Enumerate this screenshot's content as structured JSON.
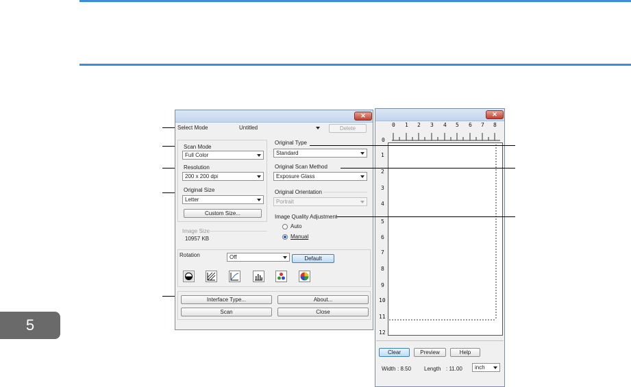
{
  "chapter": "5",
  "scanner_dialog": {
    "select_mode_label": "Select Mode",
    "select_mode_value": "Untitled",
    "delete_label": "Delete",
    "scan_mode_label": "Scan Mode",
    "scan_mode_value": "Full Color",
    "resolution_label": "Resolution",
    "resolution_value": "200 x 200 dpi",
    "original_size_label": "Original Size",
    "original_size_value": "Letter",
    "custom_size_label": "Custom Size...",
    "image_size_label": "Image Size",
    "image_size_value": "10957 KB",
    "original_type_label": "Original Type",
    "original_type_value": "Standard",
    "scan_method_label": "Original Scan Method",
    "scan_method_value": "Exposure Glass",
    "orientation_label": "Original Orientation",
    "orientation_value": "Portrait",
    "quality_label": "Image Quality Adjustment",
    "auto_label": "Auto",
    "manual_label": "Manual",
    "rotation_label": "Rotation",
    "rotation_value": "Off",
    "default_label": "Default",
    "interface_type_label": "Interface Type...",
    "about_label": "About...",
    "scan_label": "Scan",
    "close_label": "Close"
  },
  "preview_window": {
    "ruler_top": [
      "0",
      "1",
      "2",
      "3",
      "4",
      "5",
      "6",
      "7",
      "8"
    ],
    "ruler_left": [
      "1",
      "2",
      "3",
      "4",
      "5",
      "6",
      "7",
      "8",
      "9",
      "10",
      "11",
      "12"
    ],
    "ruler_origin": "0",
    "clear_label": "Clear",
    "preview_label": "Preview",
    "help_label": "Help",
    "width_label": "Width",
    "width_value": ": 8.50",
    "length_label": "Length",
    "length_value": ": 11.00",
    "unit_value": "inch"
  }
}
